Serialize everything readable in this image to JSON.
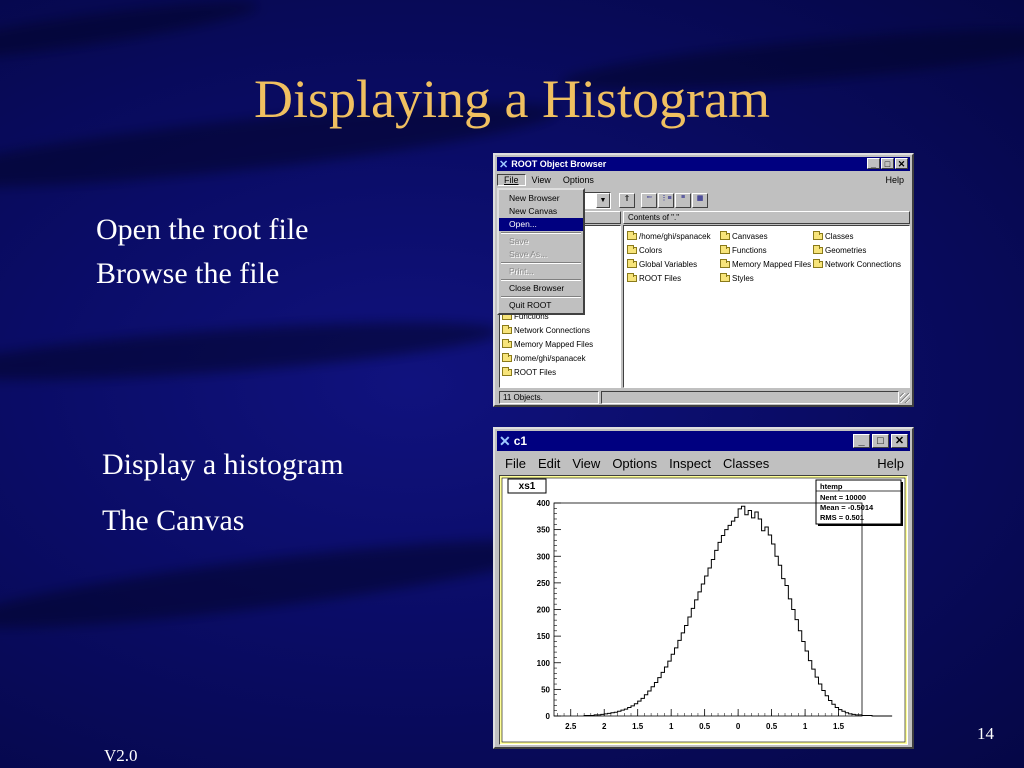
{
  "slide": {
    "title": "Displaying a Histogram",
    "bullets_top": [
      "Open the root file",
      "Browse the file"
    ],
    "bullets_bottom": [
      "Display a histogram",
      "The Canvas"
    ],
    "page_number": "14",
    "version": "V2.0"
  },
  "browser": {
    "title": "ROOT Object Browser",
    "menu": [
      "File",
      "View",
      "Options"
    ],
    "help": "Help",
    "contents_label": "Contents of \".\"",
    "dropdown": [
      {
        "label": "New Browser",
        "state": "normal"
      },
      {
        "label": "New Canvas",
        "state": "normal"
      },
      {
        "label": "Open...",
        "state": "selected"
      },
      {
        "label": "Save",
        "state": "disabled"
      },
      {
        "label": "Save As...",
        "state": "disabled"
      },
      {
        "label": "Print...",
        "state": "disabled"
      },
      {
        "label": "Close Browser",
        "state": "normal"
      },
      {
        "label": "Quit ROOT",
        "state": "normal"
      }
    ],
    "tree_items": [
      "Functions",
      "Network Connections",
      "Memory Mapped Files",
      "/home/ghi/spanacek",
      "ROOT Files"
    ],
    "contents": [
      [
        "/home/ghi/spanacek",
        "Canvases",
        "Classes"
      ],
      [
        "Colors",
        "Functions",
        "Geometries"
      ],
      [
        "Global Variables",
        "Memory Mapped Files",
        "Network Connections"
      ],
      [
        "ROOT Files",
        "Styles",
        ""
      ]
    ],
    "status": "11 Objects."
  },
  "canvas": {
    "title": "c1",
    "menu": [
      "File",
      "Edit",
      "View",
      "Options",
      "Inspect",
      "Classes"
    ],
    "help": "Help",
    "hist_name": "xs1",
    "stats": {
      "name": "htemp",
      "entries": "Nent = 10000",
      "mean": "Mean  = -0.5014",
      "rms": "RMS   =  0.501"
    }
  },
  "chart_data": {
    "type": "bar",
    "title": "xs1",
    "xlabel": "",
    "ylabel": "",
    "x_tick_labels": [
      "2.5",
      "2",
      "1.5",
      "1",
      "0.5",
      "0",
      "0.5",
      "1",
      "1.5"
    ],
    "xlim": [
      -2.75,
      1.85
    ],
    "ylim": [
      0,
      400
    ],
    "y_ticks": [
      0,
      50,
      100,
      150,
      200,
      250,
      300,
      350,
      400
    ],
    "bin_width": 0.05,
    "x_start": -2.3,
    "values": [
      1,
      1,
      1,
      2,
      2,
      3,
      4,
      5,
      6,
      7,
      9,
      11,
      13,
      16,
      19,
      23,
      28,
      33,
      40,
      47,
      55,
      63,
      72,
      82,
      92,
      103,
      116,
      128,
      142,
      156,
      170,
      186,
      202,
      218,
      233,
      248,
      263,
      278,
      294,
      311,
      326,
      339,
      350,
      358,
      366,
      373,
      389,
      394,
      378,
      386,
      372,
      383,
      370,
      348,
      355,
      340,
      323,
      300,
      283,
      258,
      245,
      220,
      200,
      181,
      160,
      140,
      122,
      104,
      88,
      73,
      60,
      48,
      38,
      29,
      22,
      16,
      12,
      9,
      6,
      4,
      3,
      2,
      2,
      1,
      1,
      1,
      0,
      0,
      0,
      0,
      0,
      0
    ]
  }
}
